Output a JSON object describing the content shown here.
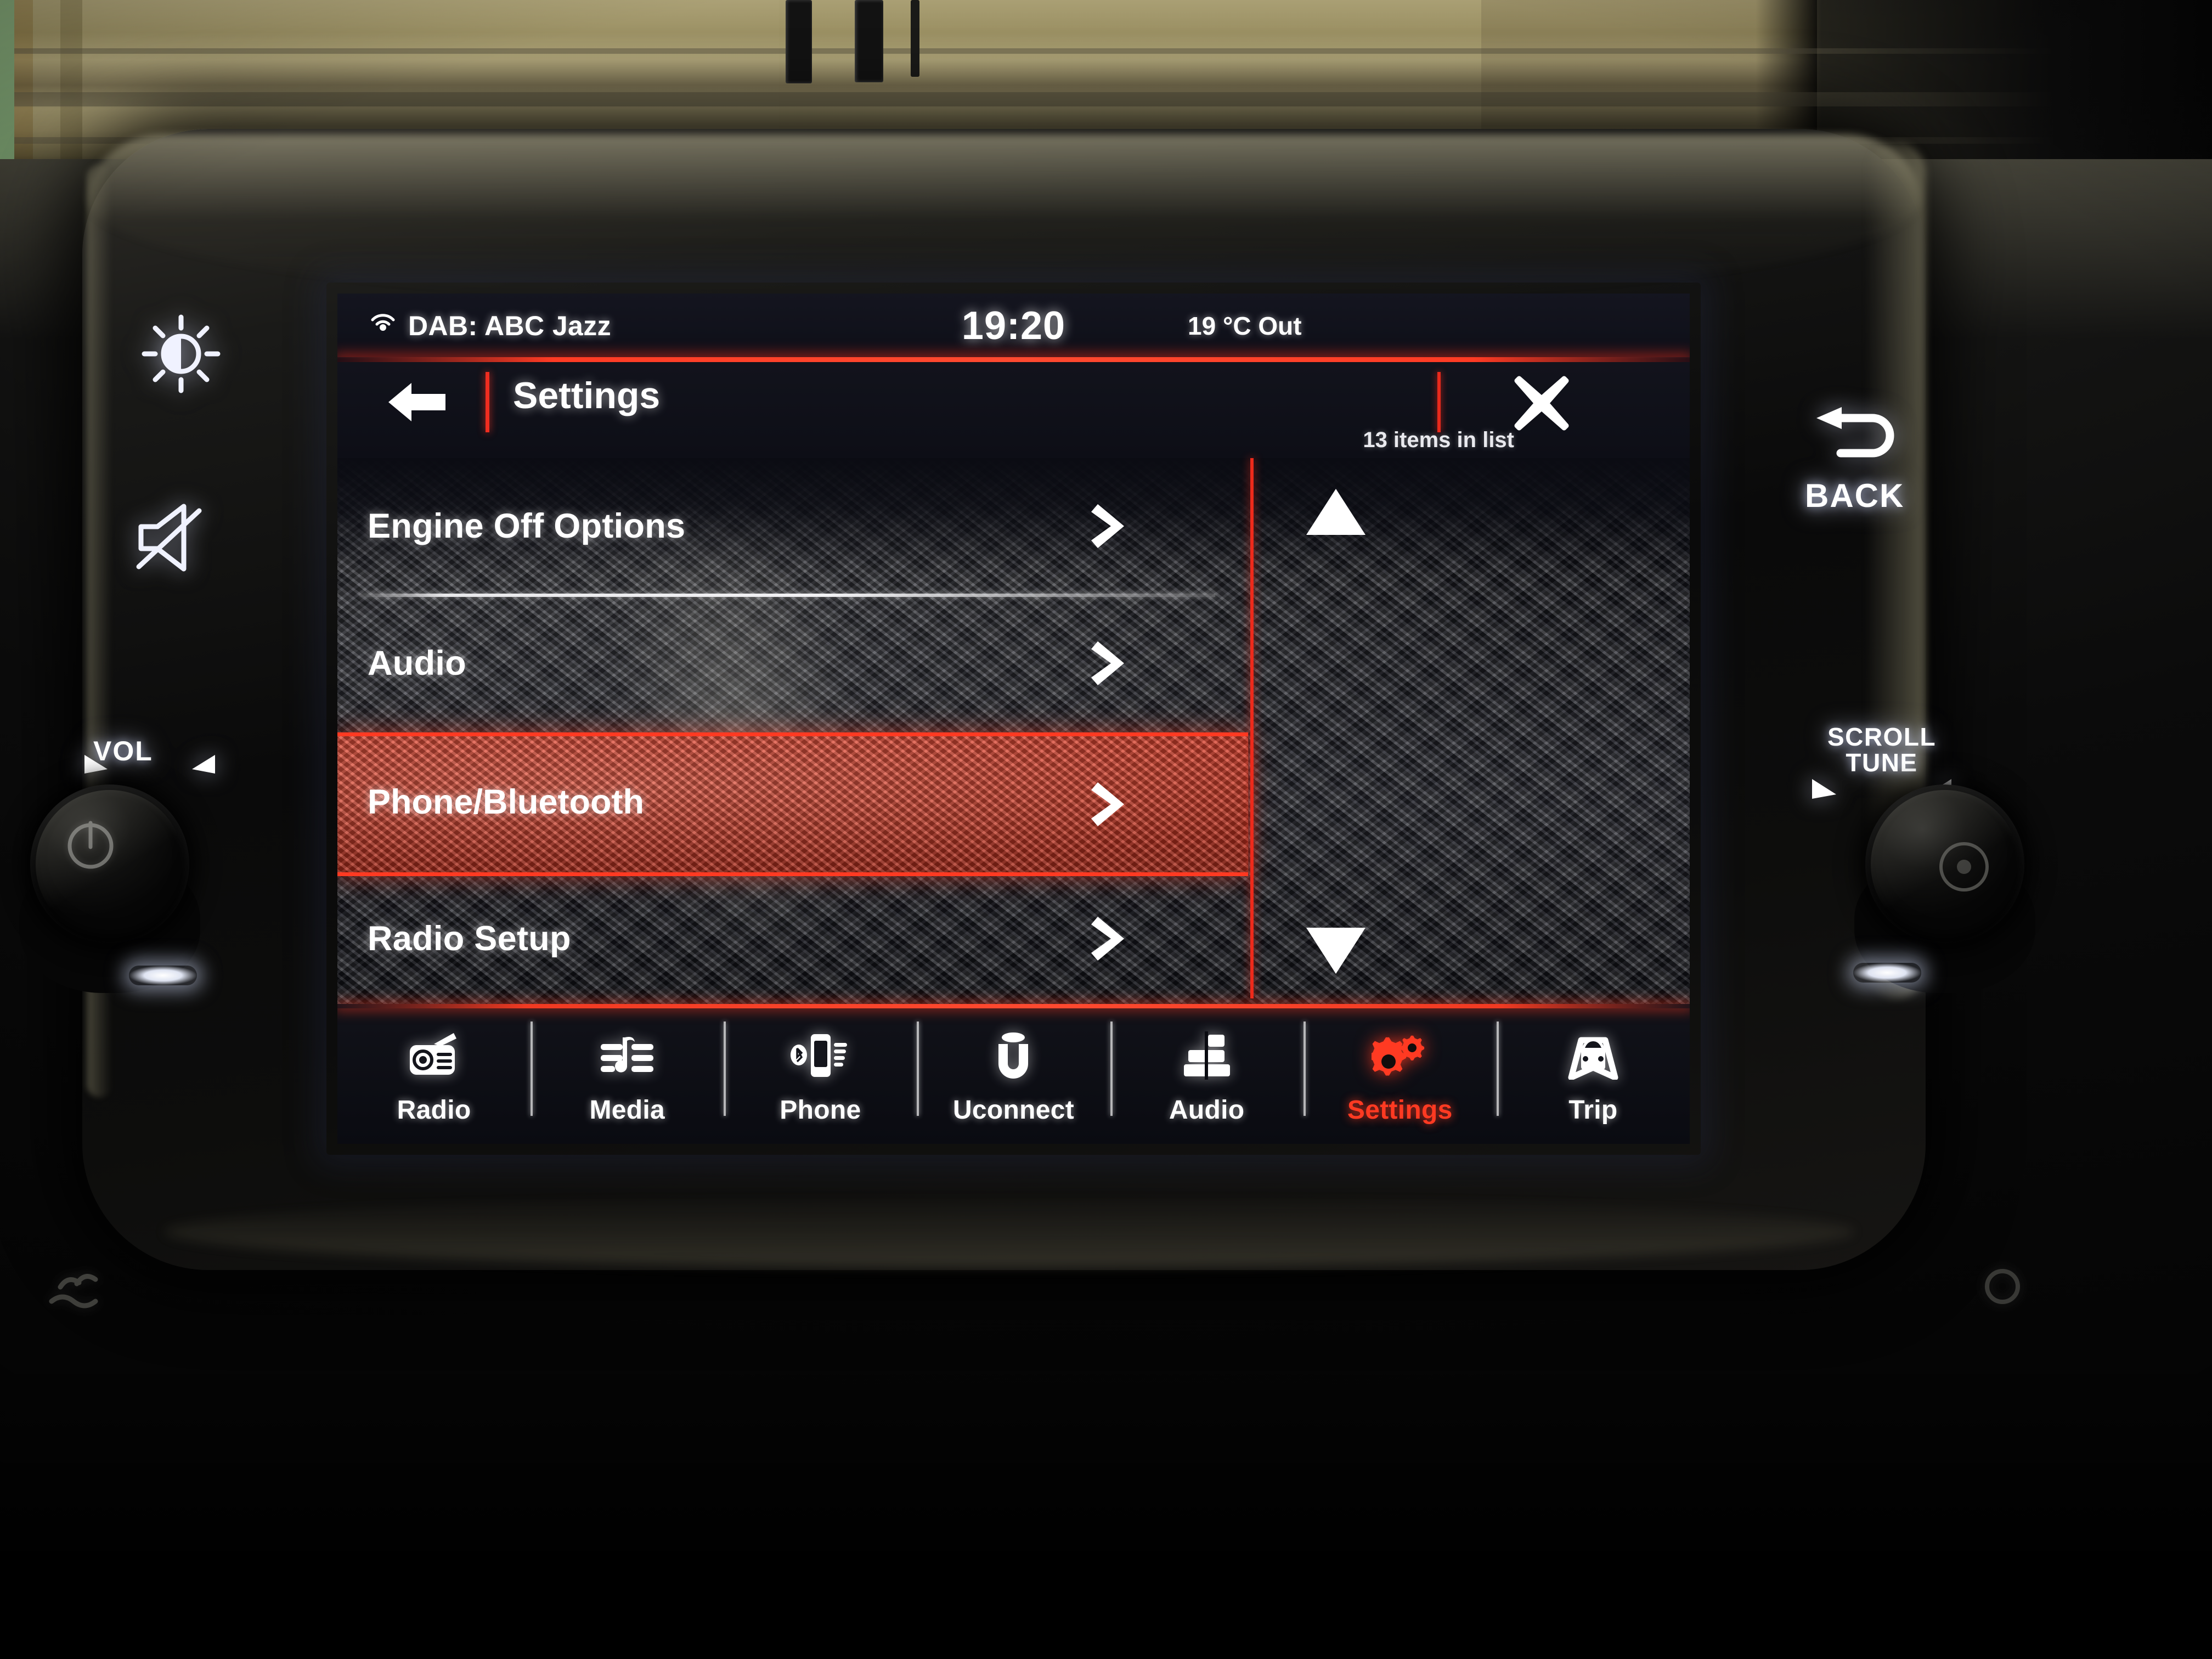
{
  "environment": {
    "description": "Fiat 500 Uconnect infotainment touchscreen photographed in a garage"
  },
  "status_bar": {
    "source_icon": "radio-wave-icon",
    "source_label": "DAB: ABC Jazz",
    "clock": "19:20",
    "temperature": "19 °C Out"
  },
  "header": {
    "back_icon": "back-arrow-icon",
    "title": "Settings",
    "item_count": "13 items in list",
    "close_icon": "close-x-icon"
  },
  "list": {
    "items": [
      {
        "label": "Engine Off Options",
        "chevron": "chevron-right-icon",
        "selected": false
      },
      {
        "label": "Audio",
        "chevron": "chevron-right-icon",
        "selected": false
      },
      {
        "label": "Phone/Bluetooth",
        "chevron": "chevron-right-icon",
        "selected": true
      },
      {
        "label": "Radio Setup",
        "chevron": "chevron-right-icon",
        "selected": false
      }
    ],
    "scroll_up_icon": "triangle-up-icon",
    "scroll_down_icon": "triangle-down-icon"
  },
  "nav": {
    "items": [
      {
        "label": "Radio",
        "icon": "radio-icon",
        "active": false
      },
      {
        "label": "Media",
        "icon": "music-note-icon",
        "active": false
      },
      {
        "label": "Phone",
        "icon": "bluetooth-phone-icon",
        "active": false
      },
      {
        "label": "Uconnect",
        "icon": "uconnect-u-icon",
        "active": false
      },
      {
        "label": "Audio",
        "icon": "equalizer-icon",
        "active": false
      },
      {
        "label": "Settings",
        "icon": "gears-icon",
        "active": true
      },
      {
        "label": "Trip",
        "icon": "car-road-icon",
        "active": false
      }
    ]
  },
  "hardware": {
    "brightness_icon": "brightness-sun-icon",
    "mute_icon": "speaker-mute-icon",
    "back_icon": "u-turn-arrow-icon",
    "back_label": "BACK",
    "scroll_label_line1": "SCROLL",
    "scroll_label_line2": "TUNE",
    "volume_label": "VOL",
    "volume_knob": "power-volume-knob",
    "tune_knob": "scroll-tune-knob"
  },
  "colors": {
    "accent_red": "#ff3a22",
    "highlight_red": "#c43522",
    "screen_bg": "#0e0f17",
    "text_white": "#ffffff"
  }
}
